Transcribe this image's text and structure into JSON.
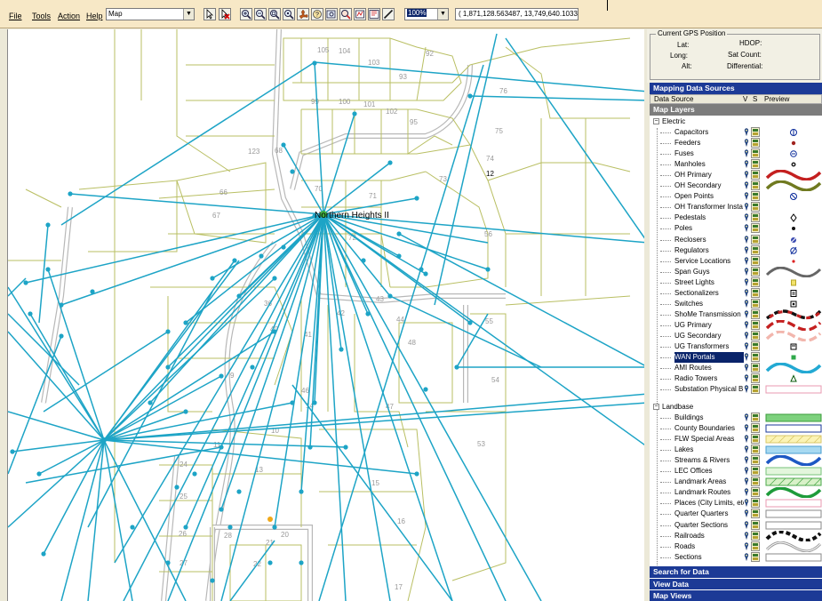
{
  "menu": {
    "file": "File",
    "tools": "Tools",
    "action": "Action",
    "help": "Help"
  },
  "toolbar": {
    "map_dropdown_value": "Map",
    "zoom_value": "100%",
    "coords": "( 1,871,128.563487, 13,749,640.1033",
    "tools": [
      "pointer-icon",
      "select-clear-icon",
      "zoom-in-icon",
      "zoom-out-icon",
      "zoom-full-icon",
      "zoom-area-icon",
      "pan-icon",
      "identify-icon",
      "find-icon",
      "route-icon",
      "measure-area-icon",
      "layout-icon",
      "measure-line-icon"
    ]
  },
  "map": {
    "label": "Northern Heights II",
    "parcels": [
      "105",
      "104",
      "103",
      "93",
      "92",
      "99",
      "100",
      "101",
      "102",
      "95",
      "76",
      "75",
      "74",
      "73",
      "123",
      "68",
      "70",
      "71",
      "66",
      "67",
      "56",
      "42",
      "43",
      "44",
      "41",
      "40",
      "36",
      "9",
      "11",
      "10",
      "13",
      "14",
      "15",
      "16",
      "17",
      "20",
      "21",
      "22",
      "24",
      "25",
      "26",
      "27",
      "28",
      "46",
      "47",
      "48",
      "53",
      "54",
      "55",
      "72",
      "12"
    ],
    "colors": {
      "parcel_line": "#b9bf63",
      "road": "#b8b8b8",
      "connection": "#1da4c6",
      "node": "#1da4c6",
      "hub": "#3fae3f",
      "highlight_node": "#f0a818"
    }
  },
  "gps": {
    "title": "Current GPS Position",
    "lat": "Lat:",
    "long": "Long:",
    "alt": "Alt:",
    "hdop": "HDOP:",
    "sat_count": "Sat Count:",
    "differential": "Differential:"
  },
  "panel": {
    "mapping_sources": "Mapping Data Sources",
    "col_source": "Data Source",
    "col_v": "V",
    "col_s": "S",
    "col_preview": "Preview",
    "map_layers": "Map Layers",
    "search": "Search for Data",
    "view_data": "View Data",
    "map_views": "Map Views"
  },
  "groups": {
    "electric": {
      "label": "Electric",
      "expander": "−"
    },
    "landbase": {
      "label": "Landbase",
      "expander": "−"
    }
  },
  "electric_layers": [
    {
      "label": "Capacitors",
      "preview": "capacitor-symbol"
    },
    {
      "label": "Feeders",
      "preview": "feeder-symbol"
    },
    {
      "label": "Fuses",
      "preview": "fuse-symbol"
    },
    {
      "label": "Manholes",
      "preview": "manhole-symbol"
    },
    {
      "label": "OH Primary",
      "preview": "red-wave-line"
    },
    {
      "label": "OH Secondary",
      "preview": "olive-wave-line"
    },
    {
      "label": "Open Points",
      "preview": "open-point-symbol"
    },
    {
      "label": "OH Transformer Insta",
      "preview": ""
    },
    {
      "label": "Pedestals",
      "preview": "diamond-symbol"
    },
    {
      "label": "Poles",
      "preview": "dot-symbol"
    },
    {
      "label": "Reclosers",
      "preview": "recloser-symbol"
    },
    {
      "label": "Regulators",
      "preview": "regulator-symbol"
    },
    {
      "label": "Service Locations",
      "preview": "red-dot-symbol"
    },
    {
      "label": "Span Guys",
      "preview": "gray-wave-line"
    },
    {
      "label": "Street Lights",
      "preview": "street-light-symbol"
    },
    {
      "label": "Sectionalizers",
      "preview": "sectionalizer-symbol"
    },
    {
      "label": "Switches",
      "preview": "switch-symbol"
    },
    {
      "label": "ShoMe Transmission",
      "preview": "dashed-black-red-line"
    },
    {
      "label": "UG Primary",
      "preview": "dashed-red-line"
    },
    {
      "label": "UG Secondary",
      "preview": "dashed-pink-line"
    },
    {
      "label": "UG Transformers",
      "preview": "transformer-symbol"
    },
    {
      "label": "WAN Portals",
      "preview": "green-square-symbol"
    },
    {
      "label": "AMI Routes",
      "preview": "cyan-wave-line"
    },
    {
      "label": "Radio Towers",
      "preview": "triangle-symbol"
    },
    {
      "label": "Substation Physical B",
      "preview": "pink-box"
    }
  ],
  "landbase_layers": [
    {
      "label": "Buildings",
      "preview": "green-box"
    },
    {
      "label": "County Boundaries",
      "preview": "blue-box"
    },
    {
      "label": "FLW Special Areas",
      "preview": "hatched-yellow-box"
    },
    {
      "label": "Lakes",
      "preview": "light-blue-box"
    },
    {
      "label": "Streams & Rivers",
      "preview": "blue-wave-line"
    },
    {
      "label": "LEC Offices",
      "preview": "light-green-box"
    },
    {
      "label": "Landmark Areas",
      "preview": "hatched-green-box"
    },
    {
      "label": "Landmark Routes",
      "preview": "green-wave-line"
    },
    {
      "label": "Places (City Limits, etc",
      "preview": "pink-box"
    },
    {
      "label": "Quarter Quarters",
      "preview": "white-box"
    },
    {
      "label": "Quarter Sections",
      "preview": "white-box"
    },
    {
      "label": "Railroads",
      "preview": "railroad-line"
    },
    {
      "label": "Roads",
      "preview": "gray-road-line"
    },
    {
      "label": "Sections",
      "preview": "white-box"
    }
  ],
  "selected_layer": "WAN Portals"
}
